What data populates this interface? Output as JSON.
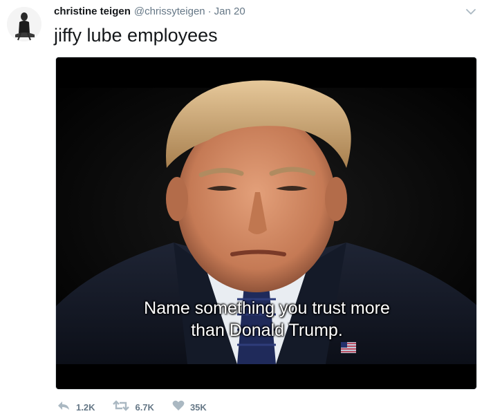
{
  "tweet": {
    "author_name": "christine teigen",
    "handle": "@chrissyteigen",
    "separator": "·",
    "timestamp": "Jan 20",
    "text": "jiffy lube employees"
  },
  "media": {
    "caption_line1": "Name something you trust more",
    "caption_line2": "than Donald Trump."
  },
  "actions": {
    "reply_count": "1.2K",
    "retweet_count": "6.7K",
    "like_count": "35K"
  },
  "icons": {
    "reply": "reply-icon",
    "retweet": "retweet-icon",
    "like": "heart-icon",
    "menu": "chevron-down-icon"
  },
  "colors": {
    "text": "#14171a",
    "muted": "#657786",
    "icon": "#aab8c2",
    "media_bg": "#000000"
  }
}
